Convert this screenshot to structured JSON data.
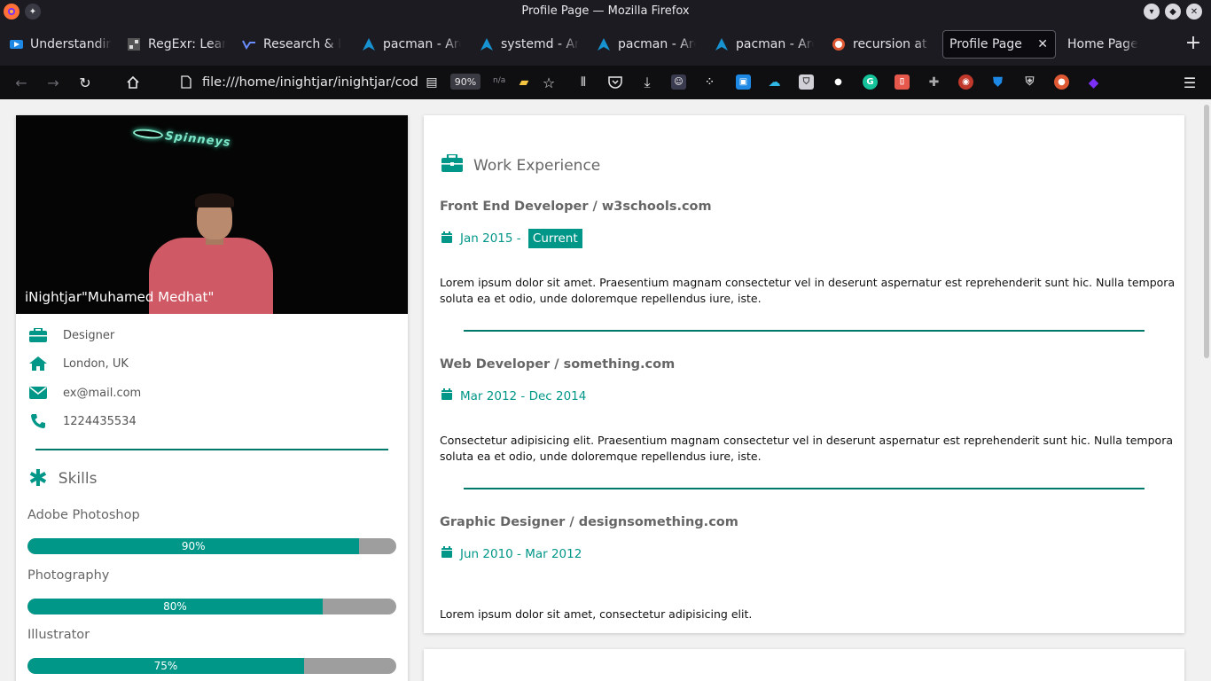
{
  "window": {
    "title": "Profile Page — Mozilla Firefox"
  },
  "tabs": [
    {
      "label": "Understanding",
      "icon": "video-icon"
    },
    {
      "label": "RegExr: Learn",
      "icon": "regexr-icon"
    },
    {
      "label": "Research & Le",
      "icon": "research-icon"
    },
    {
      "label": "pacman - Arch",
      "icon": "arch-icon"
    },
    {
      "label": "systemd - Arch",
      "icon": "arch-icon"
    },
    {
      "label": "pacman - Arch",
      "icon": "arch-icon"
    },
    {
      "label": "pacman - Arch",
      "icon": "arch-icon"
    },
    {
      "label": "recursion at D",
      "icon": "duckduckgo-icon"
    },
    {
      "label": "Profile Page",
      "icon": "",
      "active": true
    },
    {
      "label": "Home Page",
      "icon": ""
    }
  ],
  "nav": {
    "url": "file:///home/inightjar/inightjar/codeR",
    "zoom": "90%",
    "na": "n/a"
  },
  "profile": {
    "name": "iNightjar\"Muhamed Medhat\"",
    "sign_text": "Spinneys",
    "role": "Designer",
    "location": "London, UK",
    "email": "ex@mail.com",
    "phone": "1224435534"
  },
  "skills": {
    "title": "Skills",
    "items": [
      {
        "name": "Adobe Photoshop",
        "percent": 90,
        "label": "90%"
      },
      {
        "name": "Photography",
        "percent": 80,
        "label": "80%"
      },
      {
        "name": "Illustrator",
        "percent": 75,
        "label": "75%"
      }
    ]
  },
  "work": {
    "title": "Work Experience",
    "jobs": [
      {
        "title": "Front End Developer / w3schools.com",
        "date": "Jan 2015 - ",
        "badge": "Current",
        "desc": "Lorem ipsum dolor sit amet. Praesentium magnam consectetur vel in deserunt aspernatur est reprehenderit sunt hic. Nulla tempora soluta ea et odio, unde doloremque repellendus iure, iste."
      },
      {
        "title": "Web Developer / something.com",
        "date": "Mar 2012 - Dec 2014",
        "desc": "Consectetur adipisicing elit. Praesentium magnam consectetur vel in deserunt aspernatur est reprehenderit sunt hic. Nulla tempora soluta ea et odio, unde doloremque repellendus iure, iste."
      },
      {
        "title": "Graphic Designer / designsomething.com",
        "date": "Jun 2010 - Mar 2012",
        "desc": "Lorem ipsum dolor sit amet, consectetur adipisicing elit."
      }
    ]
  },
  "colors": {
    "accent": "#009688",
    "divider": "#00796b",
    "bar_track": "#9e9e9e"
  }
}
